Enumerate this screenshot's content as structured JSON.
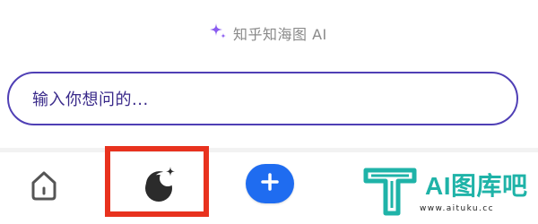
{
  "header": {
    "brand_text": "知乎知海图 AI",
    "sparkle_icon": "sparkle-icon"
  },
  "search": {
    "placeholder": "输入你想问的..."
  },
  "bottom_nav": {
    "items": [
      {
        "icon": "home-icon"
      },
      {
        "icon": "moon-star-icon"
      },
      {
        "icon": "plus-icon"
      }
    ]
  },
  "watermark": {
    "brand": "AI图库吧",
    "url": "www.aituku.cc"
  },
  "colors": {
    "accent_purple": "#4f3fb5",
    "sparkle_purple": "#8a5cf0",
    "add_button_blue": "#1f6cf0",
    "highlight_red": "#e8321e",
    "watermark_teal": "#1fb3a8"
  }
}
